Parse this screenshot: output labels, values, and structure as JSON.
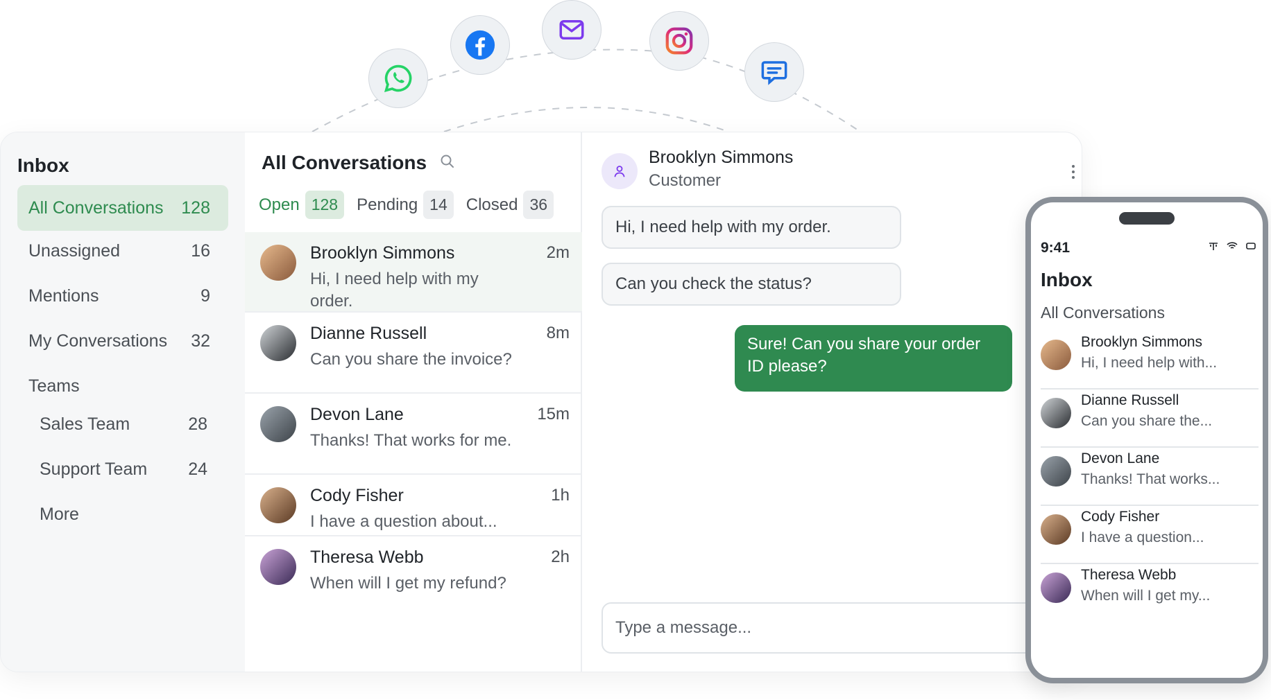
{
  "channels": [
    {
      "name": "WhatsApp",
      "icon": "whatsapp-icon",
      "color": "#25D366"
    },
    {
      "name": "Facebook",
      "icon": "facebook-icon",
      "color": "#1877F2"
    },
    {
      "name": "Email",
      "icon": "mail-icon",
      "color": "#7C3AED"
    },
    {
      "name": "Instagram",
      "icon": "instagram-icon",
      "color": "#E1306C"
    },
    {
      "name": "Messages",
      "icon": "chat-icon",
      "color": "#1E6FE0"
    }
  ],
  "sidebar": {
    "title": "Inbox",
    "items": [
      {
        "label": "All Conversations",
        "count": "128"
      },
      {
        "label": "Unassigned",
        "count": "16"
      },
      {
        "label": "Mentions",
        "count": "9"
      },
      {
        "label": "My Conversations",
        "count": "32"
      },
      {
        "label": "Teams",
        "count": ""
      }
    ],
    "teams": [
      {
        "label": "Sales Team",
        "count": "28"
      },
      {
        "label": "Support Team",
        "count": "24"
      },
      {
        "label": "More",
        "count": ""
      }
    ]
  },
  "list": {
    "title": "All Conversations",
    "tabs": [
      {
        "label": "Open",
        "count": "128"
      },
      {
        "label": "Pending",
        "count": "14"
      },
      {
        "label": "Closed",
        "count": "36"
      }
    ],
    "conversations": [
      {
        "name": "Brooklyn Simmons",
        "time": "2m",
        "message": "Hi, I need help with my order."
      },
      {
        "name": "Dianne Russell",
        "time": "8m",
        "message": "Can you share the invoice?"
      },
      {
        "name": "Devon Lane",
        "time": "15m",
        "message": "Thanks! That works for me."
      },
      {
        "name": "Cody Fisher",
        "time": "1h",
        "message": "I have a question about..."
      },
      {
        "name": "Theresa Webb",
        "time": "2h",
        "message": "When will I get my refund?"
      }
    ]
  },
  "chat": {
    "contact_name": "Brooklyn Simmons",
    "contact_role": "Customer",
    "incoming": [
      "Hi, I need help with my order.",
      "Can you check the status?"
    ],
    "outgoing": "Sure! Can you share your order ID please?",
    "composer_placeholder": "Type a message..."
  },
  "phone": {
    "time": "9:41",
    "title": "Inbox",
    "subtitle": "All Conversations",
    "items": [
      {
        "name": "Brooklyn Simmons",
        "message": "Hi, I need help with..."
      },
      {
        "name": "Dianne Russell",
        "message": "Can you share the..."
      },
      {
        "name": "Devon Lane",
        "message": "Thanks! That works..."
      },
      {
        "name": "Cody Fisher",
        "message": "I have a question..."
      },
      {
        "name": "Theresa Webb",
        "message": "When will I get my..."
      }
    ]
  },
  "colors": {
    "accent": "#2e8b4f",
    "accent_bg": "#dcebdf",
    "outgoing_bubble": "#2f8a50"
  }
}
